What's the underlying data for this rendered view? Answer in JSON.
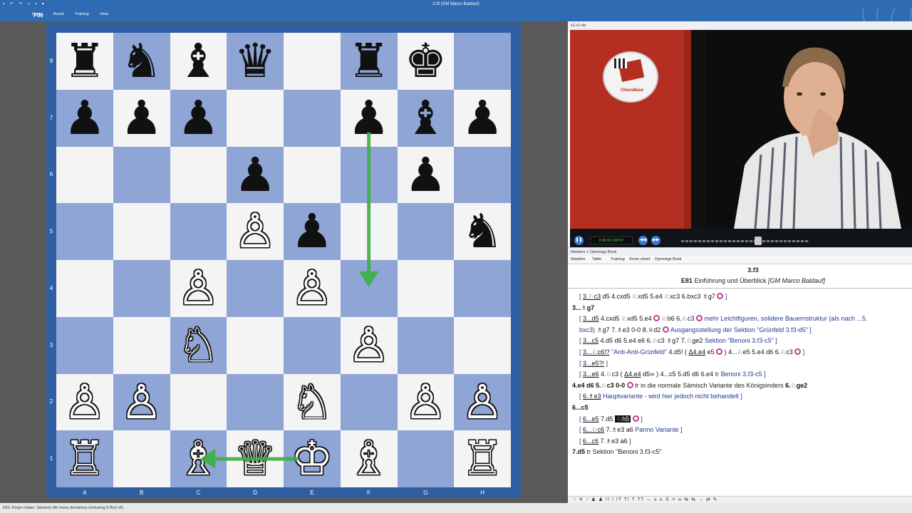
{
  "window": {
    "title": "3.f3  (GM Marco Baldauf)",
    "quick_access": "▪ ↶ ↷ ▪ ▪ ▾"
  },
  "ribbon": {
    "tabs": [
      "File",
      "Home",
      "Board",
      "Training",
      "View"
    ]
  },
  "board": {
    "files": [
      "A",
      "B",
      "C",
      "D",
      "E",
      "F",
      "G",
      "H"
    ],
    "ranks": [
      "8",
      "7",
      "6",
      "5",
      "4",
      "3",
      "2",
      "1"
    ],
    "colors": {
      "light": "#f4f4f4",
      "dark": "#8fa5d6",
      "arrow": "#3cb043"
    },
    "pieces": [
      {
        "square": "a8",
        "glyph": "♜",
        "color": "black"
      },
      {
        "square": "b8",
        "glyph": "♞",
        "color": "black"
      },
      {
        "square": "c8",
        "glyph": "♝",
        "color": "black"
      },
      {
        "square": "d8",
        "glyph": "♛",
        "color": "black"
      },
      {
        "square": "f8",
        "glyph": "♜",
        "color": "black"
      },
      {
        "square": "g8",
        "glyph": "♚",
        "color": "black"
      },
      {
        "square": "a7",
        "glyph": "♟",
        "color": "black"
      },
      {
        "square": "b7",
        "glyph": "♟",
        "color": "black"
      },
      {
        "square": "c7",
        "glyph": "♟",
        "color": "black"
      },
      {
        "square": "f7",
        "glyph": "♟",
        "color": "black"
      },
      {
        "square": "g7",
        "glyph": "♝",
        "color": "black"
      },
      {
        "square": "h7",
        "glyph": "♟",
        "color": "black"
      },
      {
        "square": "d6",
        "glyph": "♟",
        "color": "black"
      },
      {
        "square": "g6",
        "glyph": "♟",
        "color": "black"
      },
      {
        "square": "d5",
        "glyph": "♙",
        "color": "white"
      },
      {
        "square": "e5",
        "glyph": "♟",
        "color": "black"
      },
      {
        "square": "h5",
        "glyph": "♞",
        "color": "black"
      },
      {
        "square": "c4",
        "glyph": "♙",
        "color": "white"
      },
      {
        "square": "e4",
        "glyph": "♙",
        "color": "white"
      },
      {
        "square": "c3",
        "glyph": "♘",
        "color": "white"
      },
      {
        "square": "f3",
        "glyph": "♙",
        "color": "white"
      },
      {
        "square": "a2",
        "glyph": "♙",
        "color": "white"
      },
      {
        "square": "b2",
        "glyph": "♙",
        "color": "white"
      },
      {
        "square": "e2",
        "glyph": "♘",
        "color": "white"
      },
      {
        "square": "g2",
        "glyph": "♙",
        "color": "white"
      },
      {
        "square": "h2",
        "glyph": "♙",
        "color": "white"
      },
      {
        "square": "a1",
        "glyph": "♖",
        "color": "white"
      },
      {
        "square": "c1",
        "glyph": "♗",
        "color": "white"
      },
      {
        "square": "d1",
        "glyph": "♕",
        "color": "white"
      },
      {
        "square": "e1",
        "glyph": "♔",
        "color": "white"
      },
      {
        "square": "f1",
        "glyph": "♗",
        "color": "white"
      },
      {
        "square": "h1",
        "glyph": "♖",
        "color": "white"
      }
    ],
    "arrows": [
      {
        "from": "f7",
        "to": "f4"
      },
      {
        "from": "e1",
        "to": "c1"
      }
    ]
  },
  "video": {
    "header": "s1-c1-de",
    "logo_text": "ChessBase",
    "timecode": "0:06:00 0:09:57",
    "play_icon": "❚❚",
    "prev_icon": "◀◀",
    "next_icon": "▶▶",
    "seek_fraction": 0.6
  },
  "notation_panel": {
    "header": "Notation + Openings Book",
    "tabs": [
      "Notation",
      "Table",
      "Training",
      "Score sheet",
      "Openings Book"
    ],
    "move": "3.f3",
    "eco": "E81",
    "title": "Einführung und Überblick",
    "author": "[GM Marco Baldauf]"
  },
  "notation_lines": [
    {
      "type": "v",
      "parts": [
        {
          "t": "[ "
        },
        {
          "t": "3.♘c3",
          "c": "mu"
        },
        {
          "t": "  d5  4.cxd5  ♘xd5  5.e4  ♘xc3  6.bxc3  ♗g7 ",
          "c": "m"
        },
        {
          "t": "",
          "c": "ic"
        },
        {
          "t": " ]"
        }
      ]
    },
    {
      "type": "main",
      "parts": [
        {
          "t": "3...♗g7",
          "c": "k"
        }
      ]
    },
    {
      "type": "v",
      "parts": [
        {
          "t": "[ "
        },
        {
          "t": "3...d5",
          "c": "mu"
        },
        {
          "t": "  4.cxd5  ♘xd5  5.e4 ",
          "c": "m"
        },
        {
          "t": "",
          "c": "ic"
        },
        {
          "t": "  ♘b6  6.♘c3 ",
          "c": "m"
        },
        {
          "t": "",
          "c": "ic"
        },
        {
          "t": " mehr Leichtfiguren, solidere Bauernstruktur (als nach ...5."
        }
      ]
    },
    {
      "type": "v",
      "parts": [
        {
          "t": "bxc3)  "
        },
        {
          "t": "♗g7  7.♗e3  0-0  8.♕d2 ",
          "c": "m"
        },
        {
          "t": "",
          "c": "ic"
        },
        {
          "t": " Ausgangsstellung der Sektion \"Grünfeld 3.f3-d5\" ]"
        }
      ]
    },
    {
      "type": "v",
      "parts": [
        {
          "t": "[ "
        },
        {
          "t": "3...c5",
          "c": "mu"
        },
        {
          "t": "  4.d5  d6  5.e4  e6  6.♘c3  ♗g7  7.♘ge2 ",
          "c": "m"
        },
        {
          "t": "Sektion \"Benoni 3.f3-c5\" ]"
        }
      ]
    },
    {
      "type": "v",
      "parts": [
        {
          "t": "[ "
        },
        {
          "t": "3...♘c6!?",
          "c": "mu"
        },
        {
          "t": " \"Anti-Anti-Grünfeld\"  "
        },
        {
          "t": "4.d5! ( ",
          "c": "m"
        },
        {
          "t": "Δ4.e4",
          "c": "mu"
        },
        {
          "t": "  e5 ",
          "c": "m"
        },
        {
          "t": "",
          "c": "ic"
        },
        {
          "t": " )  4...♘e5  5.e4  d6  6.♘c3 ",
          "c": "m"
        },
        {
          "t": "",
          "c": "ic"
        },
        {
          "t": " ]"
        }
      ]
    },
    {
      "type": "v",
      "parts": [
        {
          "t": "[ "
        },
        {
          "t": "3...e5?!",
          "c": "mu"
        },
        {
          "t": " ]"
        }
      ]
    },
    {
      "type": "v",
      "parts": [
        {
          "t": "[ "
        },
        {
          "t": "3...e6",
          "c": "mu"
        },
        {
          "t": "  4.♘c3  ( ",
          "c": "m"
        },
        {
          "t": "Δ4.e4",
          "c": "mu"
        },
        {
          "t": "  d5∞ )  4...c5  5.d5  d6  6.e4 ",
          "c": "m"
        },
        {
          "t": "tr Benoni 3.f3-c5 ]"
        }
      ]
    },
    {
      "type": "main",
      "parts": [
        {
          "t": "4.e4  d6  5.♘c3  0-0 ",
          "c": "k"
        },
        {
          "t": "",
          "c": "ic"
        },
        {
          "t": " tr in die normale Sämisch Variante des Königsinders "
        },
        {
          "t": "6.♘ge2",
          "c": "k"
        }
      ]
    },
    {
      "type": "v",
      "parts": [
        {
          "t": "[ "
        },
        {
          "t": "6.♗e3",
          "c": "mu"
        },
        {
          "t": " Hauptvariante - wird hier jedoch nicht behandelt ]"
        }
      ]
    },
    {
      "type": "main",
      "parts": [
        {
          "t": "6...c5",
          "c": "k"
        }
      ]
    },
    {
      "type": "v",
      "parts": [
        {
          "t": "[ "
        },
        {
          "t": "6...e5",
          "c": "mu"
        },
        {
          "t": "  7.d5  ",
          "c": "m"
        },
        {
          "t": "♘h5",
          "c": "hl"
        },
        {
          "t": " "
        },
        {
          "t": "",
          "c": "ic"
        },
        {
          "t": " ]"
        }
      ]
    },
    {
      "type": "v",
      "parts": [
        {
          "t": "[ "
        },
        {
          "t": "6...♘c6",
          "c": "mu"
        },
        {
          "t": "  7.♗e3  a6 ",
          "c": "m"
        },
        {
          "t": "Panno Variante ]"
        }
      ]
    },
    {
      "type": "v",
      "parts": [
        {
          "t": "[ "
        },
        {
          "t": "6...c6",
          "c": "mu"
        },
        {
          "t": "  7.♗e3  a6 ",
          "c": "m"
        },
        {
          "t": "]"
        }
      ]
    },
    {
      "type": "main",
      "parts": [
        {
          "t": "7.d5 ",
          "c": "k"
        },
        {
          "t": "tr Sektion \"Benoni 3.f3-c5\""
        }
      ]
    }
  ],
  "symbol_bar": "↑ ✕ ↑ ♟ ♟ !! ! !? ?! ? ?? ↔ ± ± ∓ = ∞ ⇆ ⇆ → ⇄ ✎",
  "status_bar": "E81: King's Indian: Sämisch 6th move deviations (including 6 Be3 c6)"
}
